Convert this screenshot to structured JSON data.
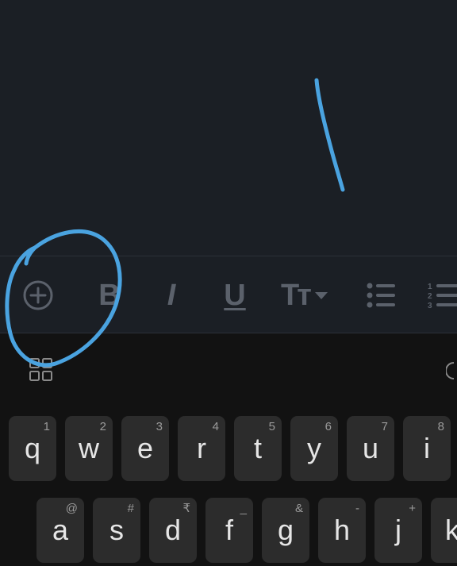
{
  "editor": {
    "content": ""
  },
  "toolbar": {
    "items": [
      {
        "label": "",
        "icon": "add-circle-icon"
      },
      {
        "label": "B",
        "icon": "bold-icon"
      },
      {
        "label": "I",
        "icon": "italic-icon"
      },
      {
        "label": "U",
        "icon": "underline-icon"
      },
      {
        "label": "Tт",
        "icon": "text-size-icon"
      },
      {
        "label": "",
        "icon": "bulleted-list-icon"
      },
      {
        "label": "",
        "icon": "numbered-list-icon"
      }
    ]
  },
  "keyboard": {
    "row1": [
      {
        "key": "q",
        "hint": "1"
      },
      {
        "key": "w",
        "hint": "2"
      },
      {
        "key": "e",
        "hint": "3"
      },
      {
        "key": "r",
        "hint": "4"
      },
      {
        "key": "t",
        "hint": "5"
      },
      {
        "key": "y",
        "hint": "6"
      },
      {
        "key": "u",
        "hint": "7"
      },
      {
        "key": "i",
        "hint": "8"
      }
    ],
    "row2": [
      {
        "key": "a",
        "hint": "@"
      },
      {
        "key": "s",
        "hint": "#"
      },
      {
        "key": "d",
        "hint": "₹"
      },
      {
        "key": "f",
        "hint": "_"
      },
      {
        "key": "g",
        "hint": "&"
      },
      {
        "key": "h",
        "hint": "-"
      },
      {
        "key": "j",
        "hint": "+"
      },
      {
        "key": "k",
        "hint": ""
      }
    ],
    "icons": [
      "apps-grid-icon"
    ]
  },
  "colors": {
    "editor_bg": "#1b1f25",
    "keyboard_bg": "#121212",
    "key_bg": "#2c2c2c",
    "annotation": "#4aa3e0",
    "toolbar_icon": "#5b616b"
  }
}
